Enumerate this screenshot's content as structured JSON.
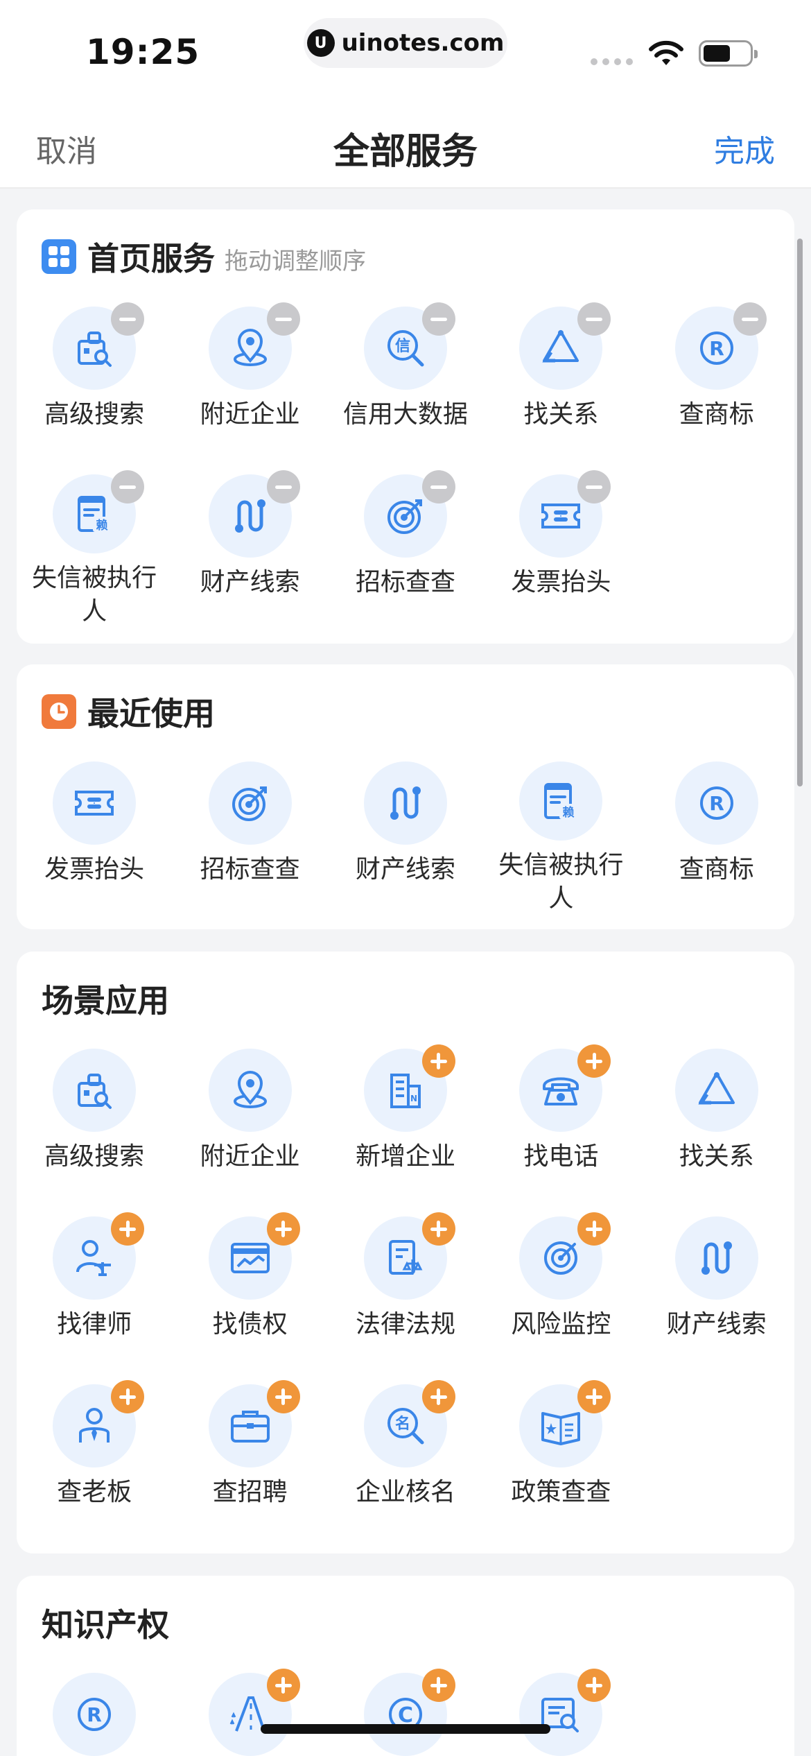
{
  "status": {
    "time": "19:25",
    "url": "uinotes.com"
  },
  "nav": {
    "cancel": "取消",
    "title": "全部服务",
    "done": "完成"
  },
  "colors": {
    "accent_blue": "#2f7de1",
    "icon_blue": "#3a86e8",
    "badge_plus": "#f0963a",
    "badge_minus": "#c9c9cc",
    "icon_bg": "#eaf2fd"
  },
  "sections": [
    {
      "title": "首页服务",
      "subtitle": "拖动调整顺序",
      "header_icon": "grid-apps-icon",
      "items": [
        {
          "label": "高级搜索",
          "icon": "advanced-search",
          "badge": "minus"
        },
        {
          "label": "附近企业",
          "icon": "location-pin",
          "badge": "minus"
        },
        {
          "label": "信用大数据",
          "icon": "credit-search",
          "badge": "minus"
        },
        {
          "label": "找关系",
          "icon": "relation-triangle",
          "badge": "minus"
        },
        {
          "label": "查商标",
          "icon": "trademark",
          "badge": "minus"
        },
        {
          "label": "失信被执行人",
          "icon": "dishonest-document",
          "badge": "minus"
        },
        {
          "label": "财产线索",
          "icon": "property-clue",
          "badge": "minus"
        },
        {
          "label": "招标查查",
          "icon": "bidding-target",
          "badge": "minus"
        },
        {
          "label": "发票抬头",
          "icon": "invoice-ticket",
          "badge": "minus"
        }
      ]
    },
    {
      "title": "最近使用",
      "subtitle": "",
      "header_icon": "clock-icon",
      "items": [
        {
          "label": "发票抬头",
          "icon": "invoice-ticket",
          "badge": ""
        },
        {
          "label": "招标查查",
          "icon": "bidding-target",
          "badge": ""
        },
        {
          "label": "财产线索",
          "icon": "property-clue",
          "badge": ""
        },
        {
          "label": "失信被执行人",
          "icon": "dishonest-document",
          "badge": ""
        },
        {
          "label": "查商标",
          "icon": "trademark",
          "badge": ""
        }
      ]
    },
    {
      "title": "场景应用",
      "subtitle": "",
      "header_icon": "",
      "items": [
        {
          "label": "高级搜索",
          "icon": "advanced-search",
          "badge": ""
        },
        {
          "label": "附近企业",
          "icon": "location-pin",
          "badge": ""
        },
        {
          "label": "新增企业",
          "icon": "new-company-building",
          "badge": "plus"
        },
        {
          "label": "找电话",
          "icon": "telephone",
          "badge": "plus"
        },
        {
          "label": "找关系",
          "icon": "relation-triangle",
          "badge": ""
        },
        {
          "label": "找律师",
          "icon": "lawyer",
          "badge": "plus"
        },
        {
          "label": "找债权",
          "icon": "debt-card",
          "badge": "plus"
        },
        {
          "label": "法律法规",
          "icon": "law-scale",
          "badge": "plus"
        },
        {
          "label": "风险监控",
          "icon": "risk-radar",
          "badge": "plus"
        },
        {
          "label": "财产线索",
          "icon": "property-clue",
          "badge": ""
        },
        {
          "label": "查老板",
          "icon": "boss-person",
          "badge": "plus"
        },
        {
          "label": "查招聘",
          "icon": "briefcase",
          "badge": "plus"
        },
        {
          "label": "企业核名",
          "icon": "name-check",
          "badge": "plus"
        },
        {
          "label": "政策查查",
          "icon": "policy-book",
          "badge": "plus"
        }
      ]
    },
    {
      "title": "知识产权",
      "subtitle": "",
      "header_icon": "",
      "items": [
        {
          "label": "",
          "icon": "trademark",
          "badge": ""
        },
        {
          "label": "",
          "icon": "patent-road",
          "badge": "plus"
        },
        {
          "label": "",
          "icon": "copyright",
          "badge": "plus"
        },
        {
          "label": "",
          "icon": "ip-search",
          "badge": "plus"
        }
      ]
    }
  ]
}
